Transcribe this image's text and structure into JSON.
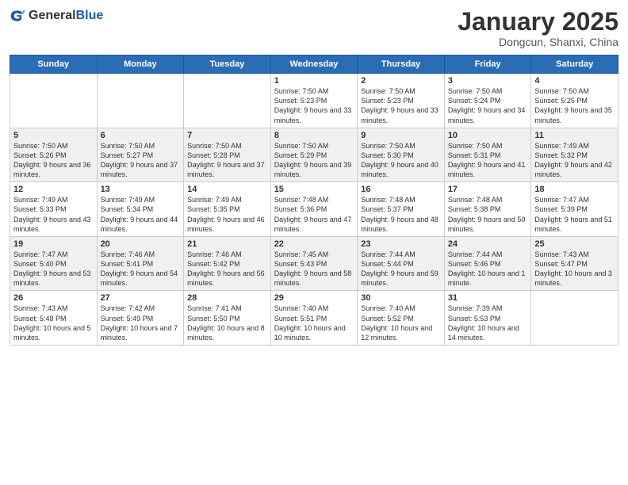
{
  "header": {
    "logo_general": "General",
    "logo_blue": "Blue",
    "month": "January 2025",
    "location": "Dongcun, Shanxi, China"
  },
  "days_of_week": [
    "Sunday",
    "Monday",
    "Tuesday",
    "Wednesday",
    "Thursday",
    "Friday",
    "Saturday"
  ],
  "weeks": [
    [
      {
        "day": "",
        "info": ""
      },
      {
        "day": "",
        "info": ""
      },
      {
        "day": "",
        "info": ""
      },
      {
        "day": "1",
        "info": "Sunrise: 7:50 AM\nSunset: 5:23 PM\nDaylight: 9 hours and 33 minutes."
      },
      {
        "day": "2",
        "info": "Sunrise: 7:50 AM\nSunset: 5:23 PM\nDaylight: 9 hours and 33 minutes."
      },
      {
        "day": "3",
        "info": "Sunrise: 7:50 AM\nSunset: 5:24 PM\nDaylight: 9 hours and 34 minutes."
      },
      {
        "day": "4",
        "info": "Sunrise: 7:50 AM\nSunset: 5:25 PM\nDaylight: 9 hours and 35 minutes."
      }
    ],
    [
      {
        "day": "5",
        "info": "Sunrise: 7:50 AM\nSunset: 5:26 PM\nDaylight: 9 hours and 36 minutes."
      },
      {
        "day": "6",
        "info": "Sunrise: 7:50 AM\nSunset: 5:27 PM\nDaylight: 9 hours and 37 minutes."
      },
      {
        "day": "7",
        "info": "Sunrise: 7:50 AM\nSunset: 5:28 PM\nDaylight: 9 hours and 37 minutes."
      },
      {
        "day": "8",
        "info": "Sunrise: 7:50 AM\nSunset: 5:29 PM\nDaylight: 9 hours and 39 minutes."
      },
      {
        "day": "9",
        "info": "Sunrise: 7:50 AM\nSunset: 5:30 PM\nDaylight: 9 hours and 40 minutes."
      },
      {
        "day": "10",
        "info": "Sunrise: 7:50 AM\nSunset: 5:31 PM\nDaylight: 9 hours and 41 minutes."
      },
      {
        "day": "11",
        "info": "Sunrise: 7:49 AM\nSunset: 5:32 PM\nDaylight: 9 hours and 42 minutes."
      }
    ],
    [
      {
        "day": "12",
        "info": "Sunrise: 7:49 AM\nSunset: 5:33 PM\nDaylight: 9 hours and 43 minutes."
      },
      {
        "day": "13",
        "info": "Sunrise: 7:49 AM\nSunset: 5:34 PM\nDaylight: 9 hours and 44 minutes."
      },
      {
        "day": "14",
        "info": "Sunrise: 7:49 AM\nSunset: 5:35 PM\nDaylight: 9 hours and 46 minutes."
      },
      {
        "day": "15",
        "info": "Sunrise: 7:48 AM\nSunset: 5:36 PM\nDaylight: 9 hours and 47 minutes."
      },
      {
        "day": "16",
        "info": "Sunrise: 7:48 AM\nSunset: 5:37 PM\nDaylight: 9 hours and 48 minutes."
      },
      {
        "day": "17",
        "info": "Sunrise: 7:48 AM\nSunset: 5:38 PM\nDaylight: 9 hours and 50 minutes."
      },
      {
        "day": "18",
        "info": "Sunrise: 7:47 AM\nSunset: 5:39 PM\nDaylight: 9 hours and 51 minutes."
      }
    ],
    [
      {
        "day": "19",
        "info": "Sunrise: 7:47 AM\nSunset: 5:40 PM\nDaylight: 9 hours and 53 minutes."
      },
      {
        "day": "20",
        "info": "Sunrise: 7:46 AM\nSunset: 5:41 PM\nDaylight: 9 hours and 54 minutes."
      },
      {
        "day": "21",
        "info": "Sunrise: 7:46 AM\nSunset: 5:42 PM\nDaylight: 9 hours and 56 minutes."
      },
      {
        "day": "22",
        "info": "Sunrise: 7:45 AM\nSunset: 5:43 PM\nDaylight: 9 hours and 58 minutes."
      },
      {
        "day": "23",
        "info": "Sunrise: 7:44 AM\nSunset: 5:44 PM\nDaylight: 9 hours and 59 minutes."
      },
      {
        "day": "24",
        "info": "Sunrise: 7:44 AM\nSunset: 5:46 PM\nDaylight: 10 hours and 1 minute."
      },
      {
        "day": "25",
        "info": "Sunrise: 7:43 AM\nSunset: 5:47 PM\nDaylight: 10 hours and 3 minutes."
      }
    ],
    [
      {
        "day": "26",
        "info": "Sunrise: 7:43 AM\nSunset: 5:48 PM\nDaylight: 10 hours and 5 minutes."
      },
      {
        "day": "27",
        "info": "Sunrise: 7:42 AM\nSunset: 5:49 PM\nDaylight: 10 hours and 7 minutes."
      },
      {
        "day": "28",
        "info": "Sunrise: 7:41 AM\nSunset: 5:50 PM\nDaylight: 10 hours and 8 minutes."
      },
      {
        "day": "29",
        "info": "Sunrise: 7:40 AM\nSunset: 5:51 PM\nDaylight: 10 hours and 10 minutes."
      },
      {
        "day": "30",
        "info": "Sunrise: 7:40 AM\nSunset: 5:52 PM\nDaylight: 10 hours and 12 minutes."
      },
      {
        "day": "31",
        "info": "Sunrise: 7:39 AM\nSunset: 5:53 PM\nDaylight: 10 hours and 14 minutes."
      },
      {
        "day": "",
        "info": ""
      }
    ]
  ]
}
